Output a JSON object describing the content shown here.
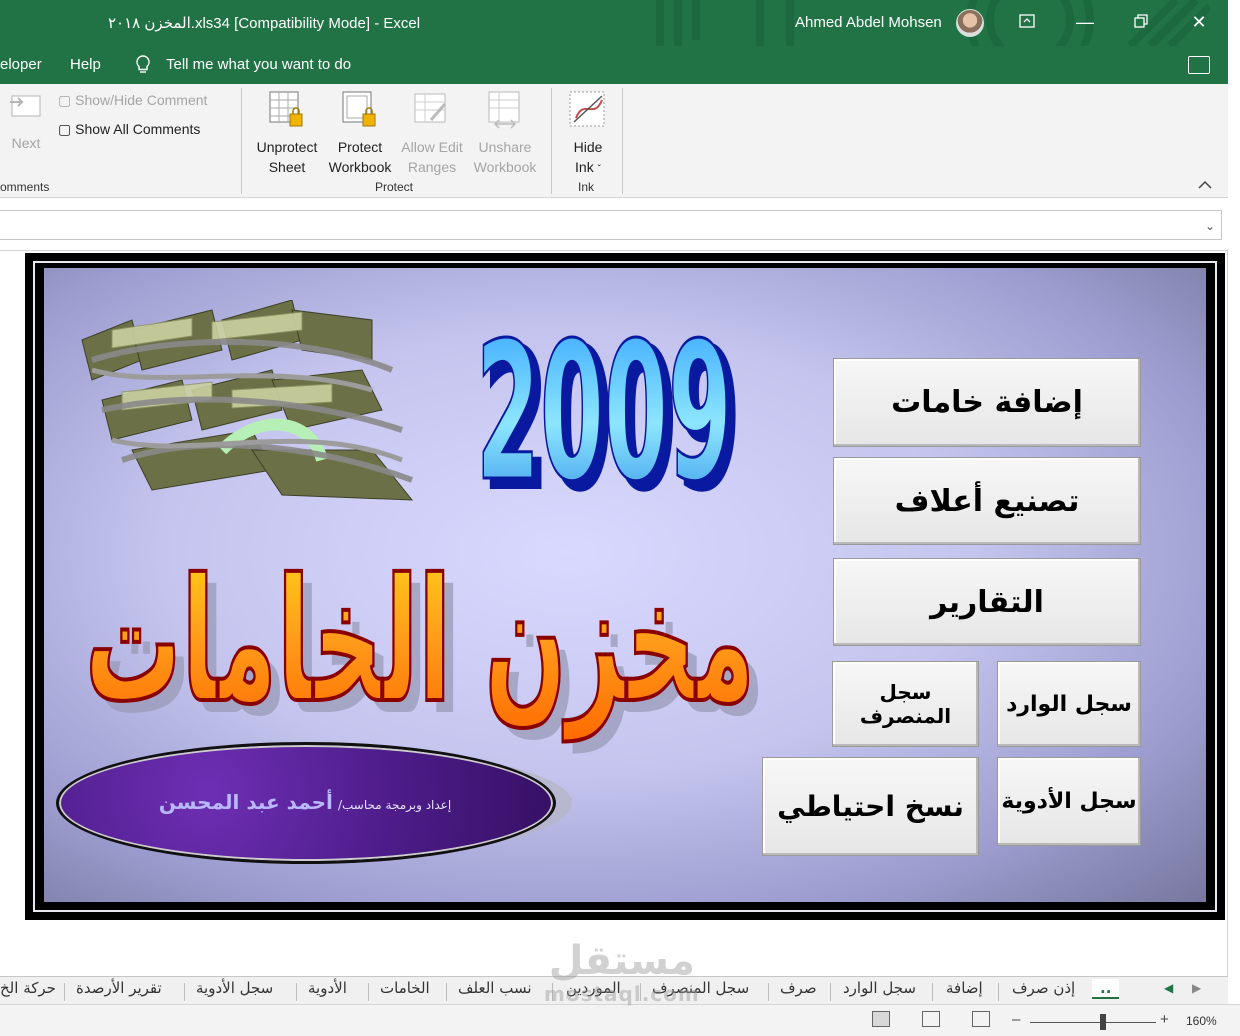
{
  "window": {
    "title": "المخزن ٢٠١٨.xls34  [Compatibility Mode]  -  Excel",
    "user": "Ahmed Abdel Mohsen"
  },
  "ribbon_tabs": {
    "developer": "eloper",
    "help": "Help",
    "tell_me": "Tell me what you want to do"
  },
  "ribbon": {
    "comments": {
      "next": "Next",
      "show_hide_comment": "Show/Hide Comment",
      "show_all_comments": "Show All Comments",
      "group_label": "omments"
    },
    "protect": {
      "unprotect_sheet_l1": "Unprotect",
      "unprotect_sheet_l2": "Sheet",
      "protect_workbook_l1": "Protect",
      "protect_workbook_l2": "Workbook",
      "allow_edit_l1": "Allow Edit",
      "allow_edit_l2": "Ranges",
      "unshare_l1": "Unshare",
      "unshare_l2": "Workbook",
      "group_label": "Protect"
    },
    "ink": {
      "hide_ink_l1": "Hide",
      "hide_ink_l2": "Ink",
      "group_label": "Ink"
    }
  },
  "sheet": {
    "year": "2009",
    "main_title": "مخزن الخامات",
    "credit_small": "إعداد وبرمجة محاسب/",
    "credit_name": "أحمد عبد المحسن",
    "buttons": {
      "add_materials": "إضافة خامات",
      "manufacture_feed": "تصنيع أعلاف",
      "reports": "التقارير",
      "incoming_log": "سجل الوارد",
      "outgoing_log": "سجل المنصرف",
      "medicines_log": "سجل الأدوية",
      "backup": "نسخ احتياطي"
    }
  },
  "sheet_tabs": [
    "..",
    "إذن صرف",
    "إضافة",
    "سجل الوارد",
    "صرف",
    "سجل المنصرف",
    "الموردين",
    "نسب العلف",
    "الخامات",
    "الأدوية",
    "سجل الأدوية",
    "تقرير الأرصدة",
    "حركة الخ"
  ],
  "status": {
    "zoom": "160%"
  },
  "watermark": {
    "arabic": "مستقل",
    "latin": "mostaql.com"
  },
  "colors": {
    "excel_green": "#217346",
    "title_orange": "#ff8c1a",
    "year_blue": "#4fb3ff"
  }
}
